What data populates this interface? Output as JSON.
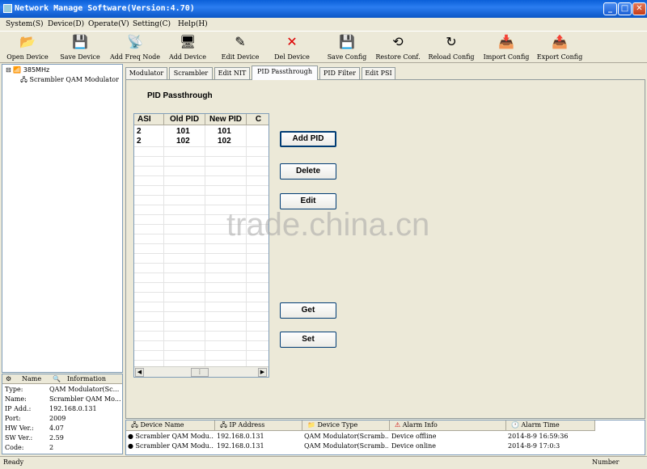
{
  "window": {
    "title": "Network Manage Software(Version:4.70)",
    "controls": {
      "minimize": "_",
      "maximize": "□",
      "close": "✕"
    }
  },
  "menu": [
    "System(S)",
    "Device(D)",
    "Operate(V)",
    "Setting(C)",
    "Help(H)"
  ],
  "toolbar": [
    {
      "label": "Open Device",
      "icon": "open-device-icon",
      "glyph": "📂"
    },
    {
      "label": "Save Device",
      "icon": "save-device-icon",
      "glyph": "💾"
    },
    {
      "label": "Add Freq Node",
      "icon": "add-freq-node-icon",
      "glyph": "📡"
    },
    {
      "label": "Add Device",
      "icon": "add-device-icon",
      "glyph": "🖥"
    },
    {
      "label": "Edit Device",
      "icon": "edit-device-icon",
      "glyph": "✎"
    },
    {
      "label": "Del Device",
      "icon": "delete-device-icon",
      "glyph": "✕"
    },
    {
      "label": "Save Config",
      "icon": "save-config-icon",
      "glyph": "💾"
    },
    {
      "label": "Restore Conf.",
      "icon": "restore-config-icon",
      "glyph": "⟲"
    },
    {
      "label": "Reload Config",
      "icon": "reload-config-icon",
      "glyph": "↻"
    },
    {
      "label": "Import Config",
      "icon": "import-config-icon",
      "glyph": "📥"
    },
    {
      "label": "Export Config",
      "icon": "export-config-icon",
      "glyph": "📤"
    }
  ],
  "tree": {
    "root": "385MHz",
    "child": "Scrambler QAM Modulator"
  },
  "info": {
    "headers": [
      "Name",
      "Information"
    ],
    "rows": [
      {
        "key": "Type:",
        "value": "QAM Modulator(Sc..."
      },
      {
        "key": "Name:",
        "value": "Scrambler QAM Mo..."
      },
      {
        "key": "IP Add.:",
        "value": "192.168.0.131"
      },
      {
        "key": "Port:",
        "value": "2009"
      },
      {
        "key": "HW Ver.:",
        "value": "4.07"
      },
      {
        "key": "SW Ver.:",
        "value": "2.59"
      },
      {
        "key": "Code:",
        "value": "2"
      }
    ]
  },
  "tabs": [
    "Modulator",
    "Scrambler",
    "Edit NIT",
    "PID Passthrough",
    "PID Filter",
    "Edit PSI"
  ],
  "active_tab": "PID Passthrough",
  "panel": {
    "title": "PID Passthrough",
    "columns": [
      "ASI",
      "Old PID",
      "New PID",
      "C"
    ],
    "rows": [
      [
        "2",
        "101",
        "101",
        ""
      ],
      [
        "2",
        "102",
        "102",
        ""
      ]
    ],
    "buttons": {
      "add": "Add PID",
      "delete": "Delete",
      "edit": "Edit",
      "get": "Get",
      "set": "Set"
    }
  },
  "watermark": "trade.china.cn",
  "log": {
    "columns": [
      "Device Name",
      "IP Address",
      "Device Type",
      "Alarm Info",
      "Alarm Time"
    ],
    "rows": [
      [
        "Scrambler QAM Modu...",
        "192.168.0.131",
        "QAM Modulator(Scramb...",
        "Device offline",
        "2014-8-9 16:59:36"
      ],
      [
        "Scrambler QAM Modu...",
        "192.168.0.131",
        "QAM Modulator(Scramb...",
        "Device online",
        "2014-8-9 17:0:3"
      ]
    ]
  },
  "status": {
    "left": "Ready",
    "right": "Number"
  }
}
